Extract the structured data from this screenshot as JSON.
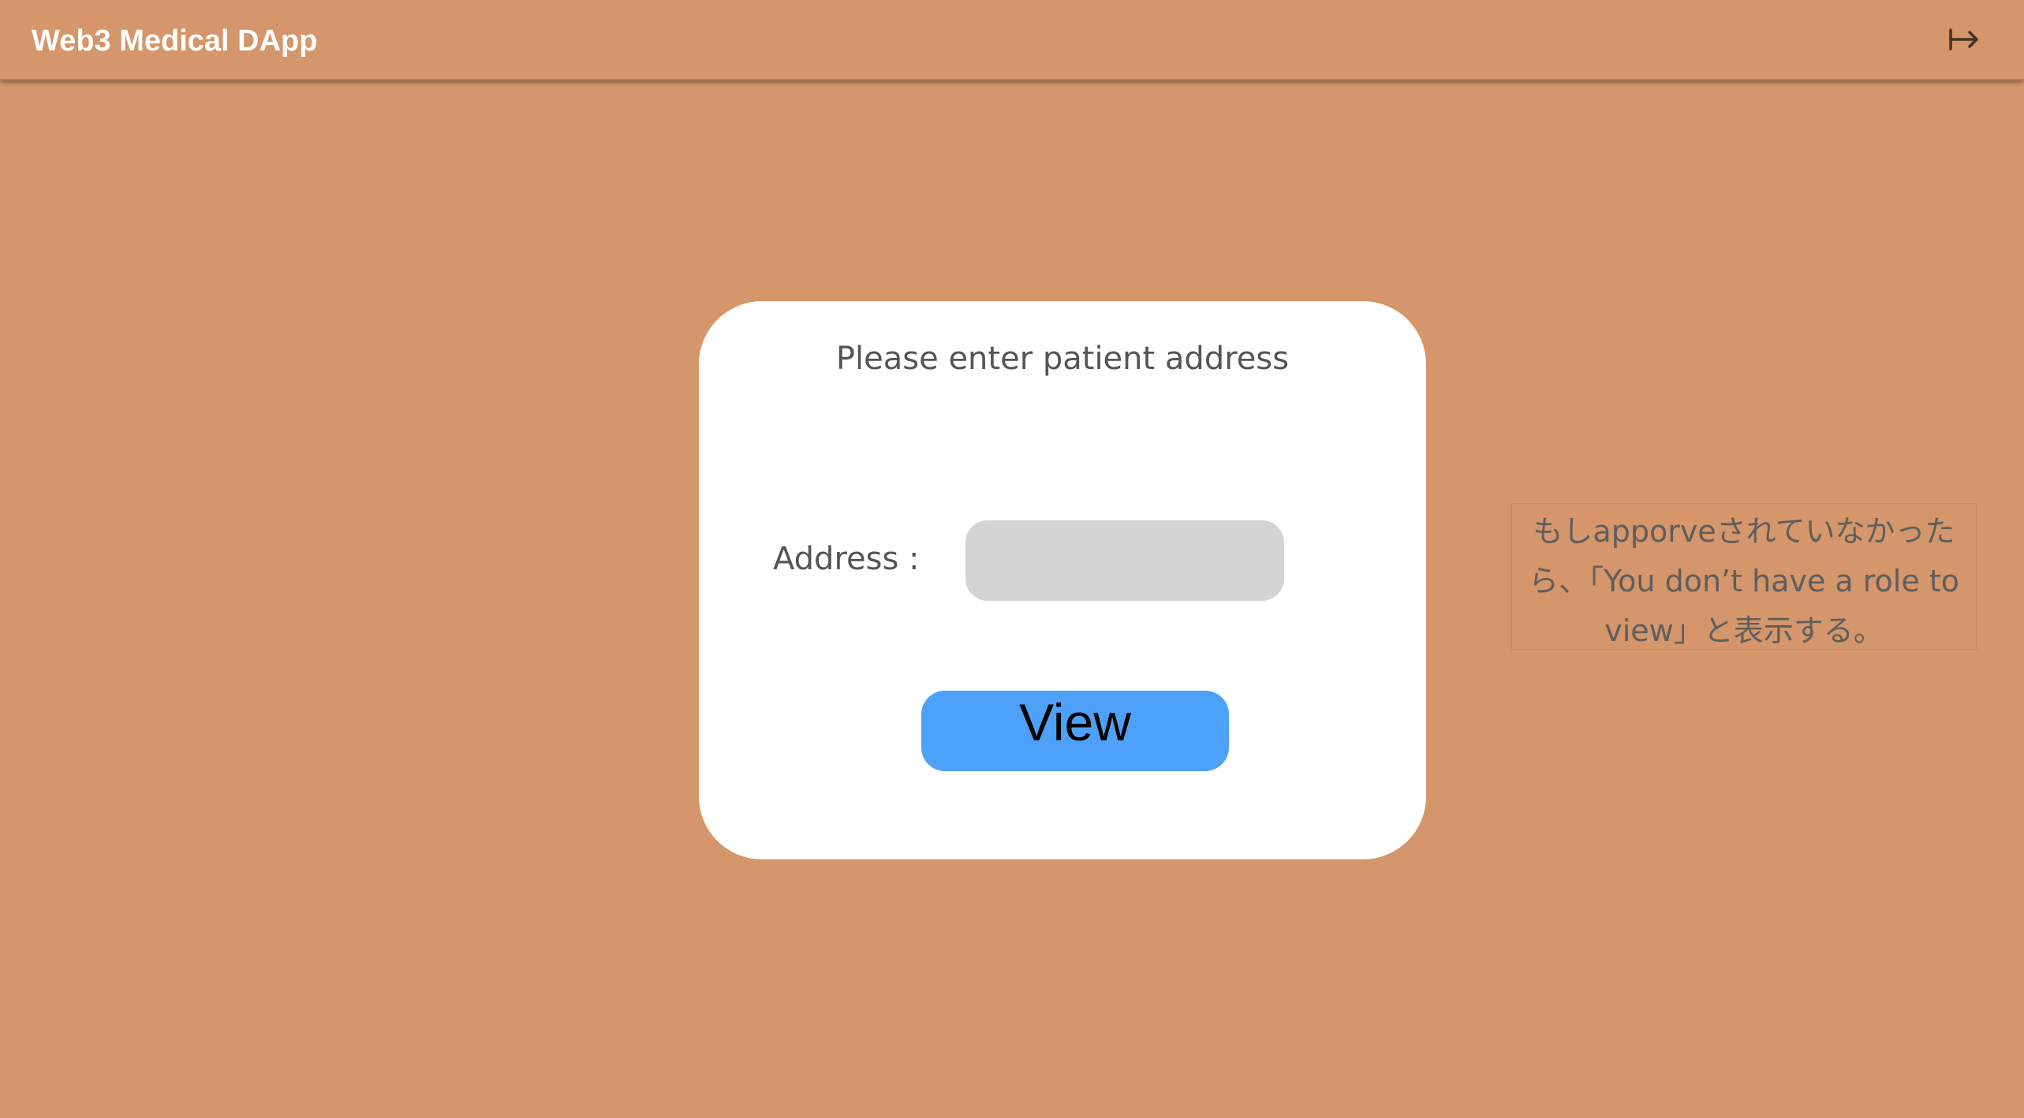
{
  "header": {
    "title": "Web3 Medical DApp",
    "logout_icon": "logout-arrow-icon"
  },
  "card": {
    "title": "Please enter patient address",
    "address_label": "Address :",
    "address_value": "",
    "address_placeholder": "",
    "view_button_label": "View"
  },
  "note": {
    "text": "もしapporveされていなかったら、「You don’t have a role to view」と表示する。"
  },
  "colors": {
    "background": "#d4966a",
    "card": "#ffffff",
    "input": "#d4d4d4",
    "button": "#4da1f8",
    "header_text": "#ffffff"
  }
}
